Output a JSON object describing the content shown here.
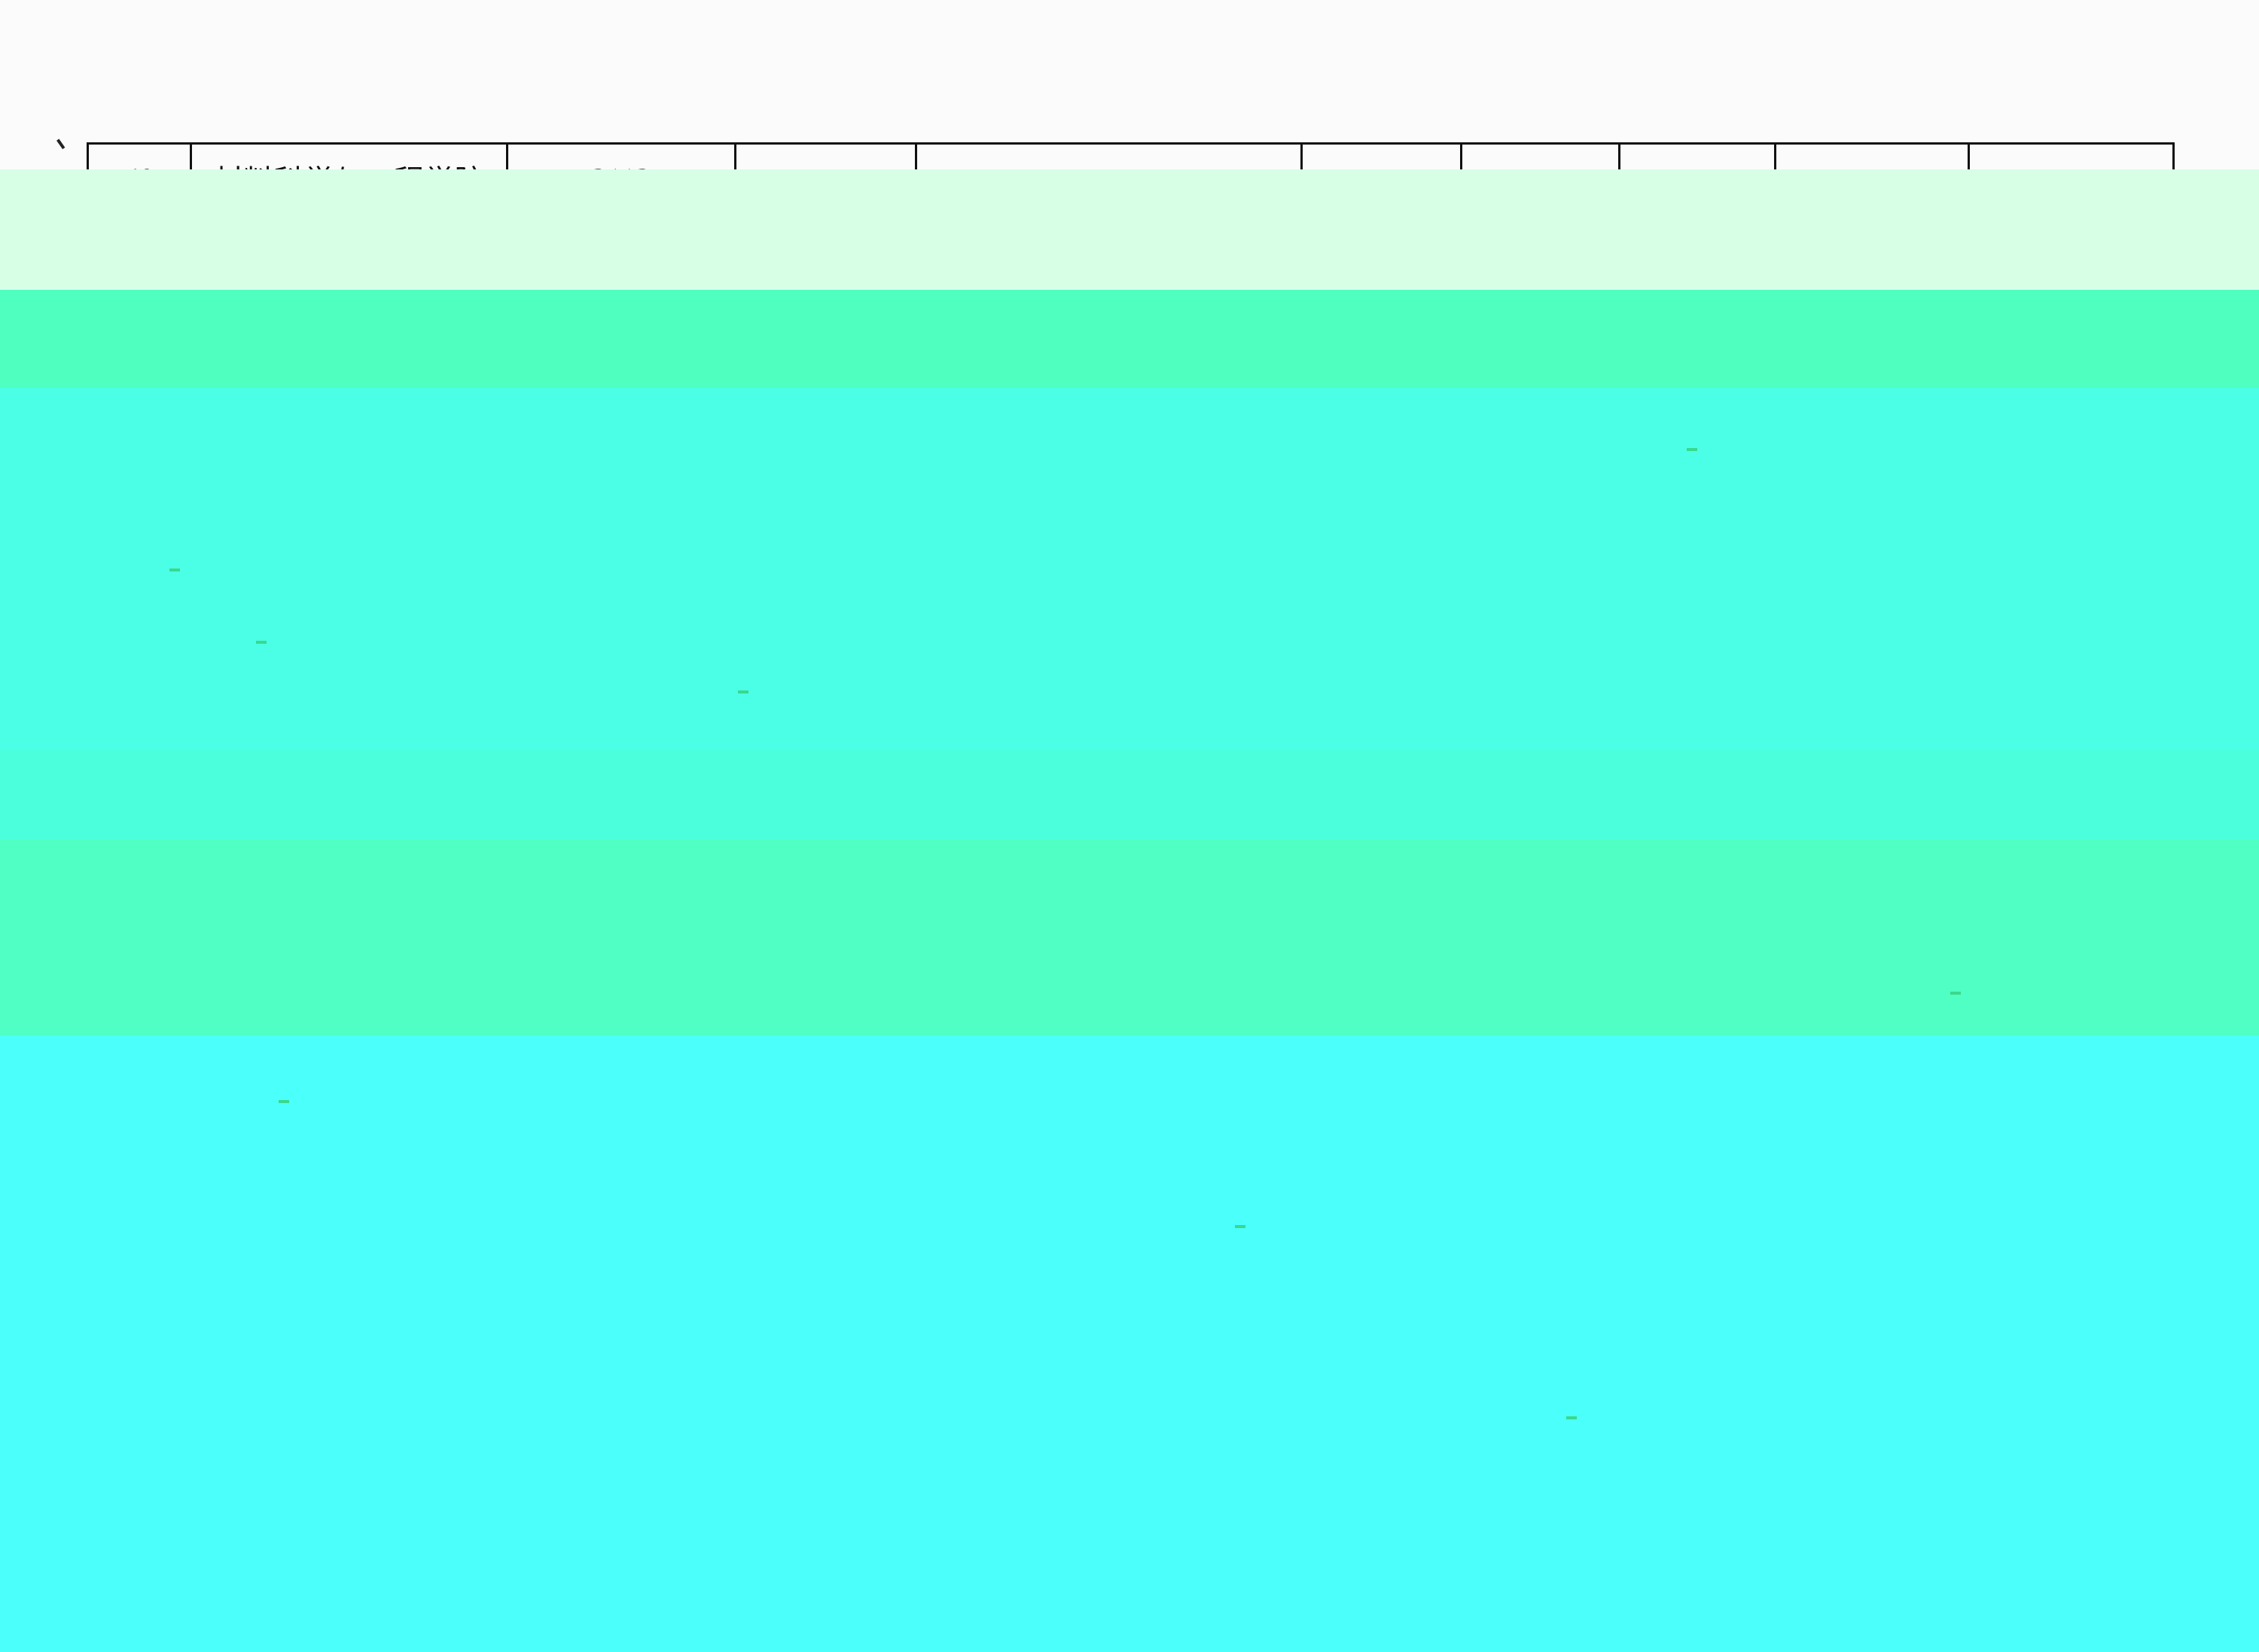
{
  "table": {
    "row": {
      "index": "40",
      "school": "材料科学与工程学院",
      "code": "2112",
      "col4": "",
      "col5": "",
      "col6": "",
      "col7": "",
      "col8": "",
      "col9": "",
      "col10": ""
    }
  },
  "colors": {
    "page_background": "#fbfbfb",
    "overlay_band_light": "#d6ffe6",
    "overlay_band_green": "#4fffc0",
    "overlay_band_cyan": "#4bfffa"
  }
}
